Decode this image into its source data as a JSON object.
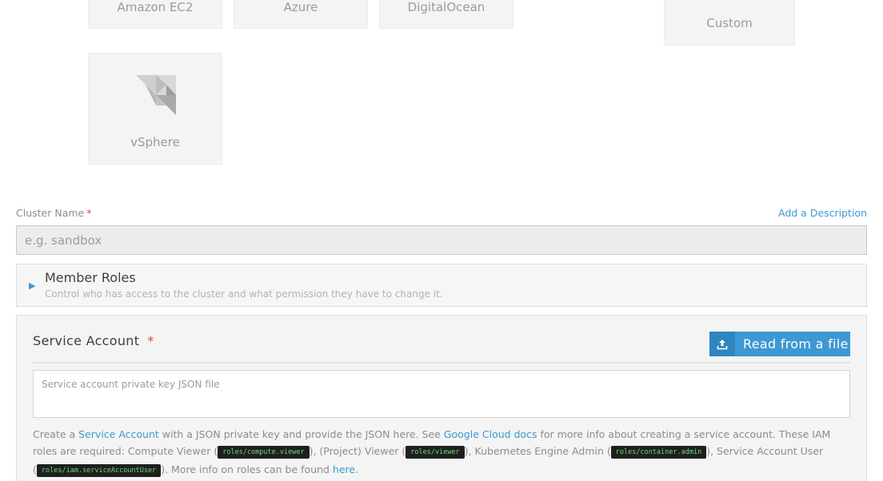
{
  "providers": {
    "ec2": "Amazon EC2",
    "azure": "Azure",
    "digitalocean": "DigitalOcean",
    "custom": "Custom",
    "vsphere": "vSphere",
    "vsphere_icon": "vsphere-logo-icon"
  },
  "cluster_name": {
    "label": "Cluster Name",
    "required_mark": "*",
    "placeholder": "e.g. sandbox",
    "add_description": "Add a Description"
  },
  "member_roles": {
    "title": "Member Roles",
    "subtitle": "Control who has access to the cluster and what permission they have to change it.",
    "toggle_icon": "triangle-right-icon"
  },
  "service_account": {
    "title": "Service Account",
    "required_mark": "*",
    "read_button": "Read from a file",
    "read_icon": "upload-icon",
    "textarea_placeholder": "Service account private key JSON file",
    "help": {
      "t1": "Create a ",
      "link_sa": "Service Account",
      "t2": " with a JSON private key and provide the JSON here. See ",
      "link_docs": "Google Cloud docs",
      "t3": " for more info about creating a service account. These IAM roles are required: Compute Viewer (",
      "code1": "roles/compute.viewer",
      "t4": "), (Project) Viewer (",
      "code2": "roles/viewer",
      "t5": "), Kubernetes Engine Admin (",
      "code3": "roles/container.admin",
      "t6": "), Service Account User (",
      "code4": "roles/iam.serviceAccountUser",
      "t7": "). More info on roles can be found ",
      "link_here": "here",
      "t8": "."
    }
  },
  "colors": {
    "accent": "#3d98d3",
    "required": "#e0443c"
  }
}
